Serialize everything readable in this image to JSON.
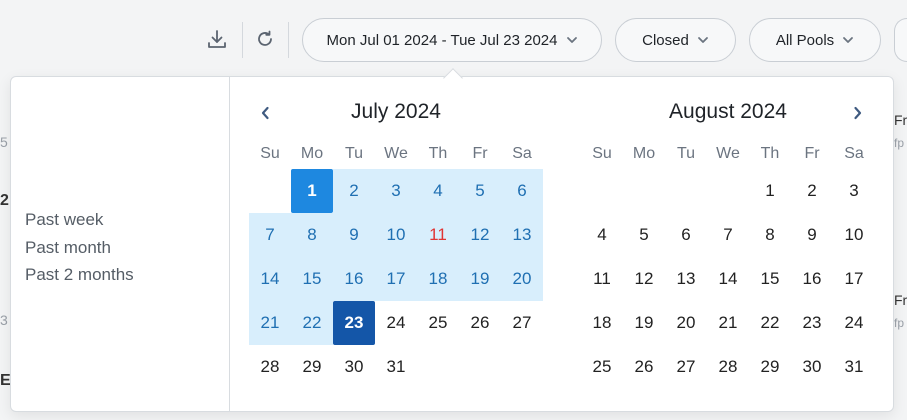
{
  "toolbar": {
    "icons": {
      "download": "download-icon",
      "refresh": "refresh-icon"
    },
    "date_range_label": "Mon Jul 01 2024 - Tue Jul 23 2024",
    "status_filter_label": "Closed",
    "pool_filter_label": "All Pools"
  },
  "background_fragments": [
    "5",
    "2",
    "3",
    "E",
    "Fr",
    "fp",
    "Fr",
    "fp"
  ],
  "date_picker": {
    "presets": [
      "Past week",
      "Past month",
      "Past 2 months"
    ],
    "weekdays": [
      "Su",
      "Mo",
      "Tu",
      "We",
      "Th",
      "Fr",
      "Sa"
    ],
    "left_month": {
      "title": "July 2024",
      "first_weekday_index": 1,
      "days_in_month": 31
    },
    "right_month": {
      "title": "August 2024",
      "first_weekday_index": 4,
      "days_in_month": 31
    },
    "range_start_day": 1,
    "range_end_day": 23,
    "today_day": 11,
    "colors": {
      "range_fill": "#d8eefc",
      "range_text": "#1f6fb2",
      "start_fill": "#1e88e0",
      "end_fill": "#1456a8",
      "today_text": "#e03434"
    }
  }
}
